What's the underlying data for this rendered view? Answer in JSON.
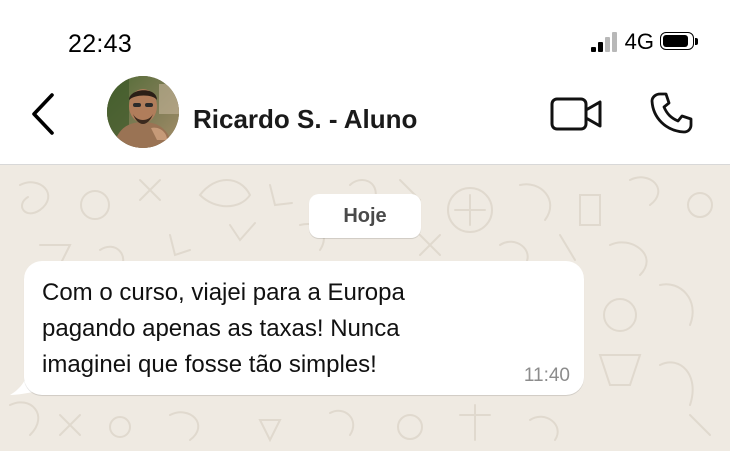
{
  "status_bar": {
    "time": "22:43",
    "network": "4G",
    "signal_bars_active": 2,
    "signal_bars_total": 4,
    "battery_level": 0.9,
    "icons": [
      "signal-icon",
      "battery-icon"
    ]
  },
  "header": {
    "contact_name": "Ricardo S. - Aluno",
    "icons": [
      "back-arrow-icon",
      "avatar-photo",
      "video-camera-icon",
      "phone-icon"
    ]
  },
  "chat": {
    "date_label": "Hoje",
    "messages": [
      {
        "text": "Com o curso, viajei para a Europa pagando apenas as taxas! Nunca imaginei que fosse tão simples!",
        "time": "11:40",
        "direction": "incoming"
      }
    ]
  },
  "colors": {
    "chat_background": "#efeae2",
    "bubble": "#ffffff",
    "wallpaper_doodle": "#e2dcd2",
    "header_text": "#1a1a1a",
    "time_text": "#8c8c8c"
  }
}
